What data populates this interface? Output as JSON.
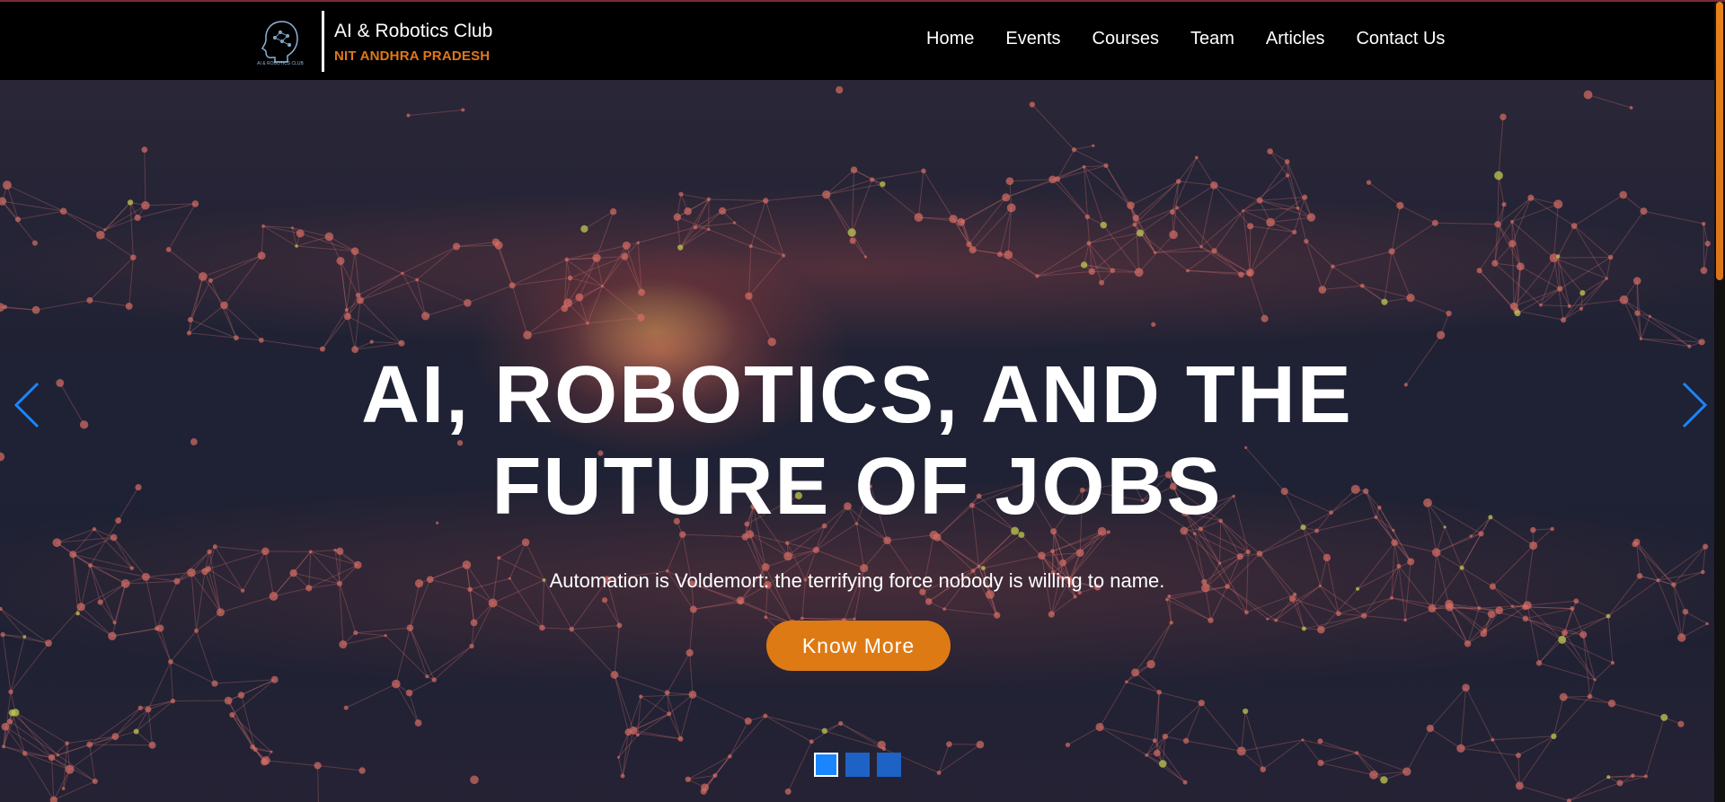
{
  "brand": {
    "title": "AI & Robotics Club",
    "subtitle": "NIT ANDHRA PRADESH",
    "logo_icon": "brain-head-logo-icon",
    "logo_text": "AI & ROBOTICS CLUB"
  },
  "nav": {
    "items": [
      {
        "label": "Home"
      },
      {
        "label": "Events"
      },
      {
        "label": "Courses"
      },
      {
        "label": "Team"
      },
      {
        "label": "Articles"
      },
      {
        "label": "Contact Us"
      }
    ]
  },
  "hero": {
    "title_line1": "AI, ROBOTICS, AND THE",
    "title_line2": "FUTURE OF JOBS",
    "subtitle": "Automation is Voldemort: the terrifying force nobody is willing to name.",
    "cta_label": "Know More",
    "prev_icon": "chevron-left-icon",
    "next_icon": "chevron-right-icon"
  },
  "carousel": {
    "slide_count": 3,
    "active_index": 0
  },
  "colors": {
    "accent": "#de7a14",
    "nav_bg": "#000000",
    "indicator": "#1e62c6",
    "indicator_active": "#1a85ff",
    "arrow": "#1a85ff"
  }
}
